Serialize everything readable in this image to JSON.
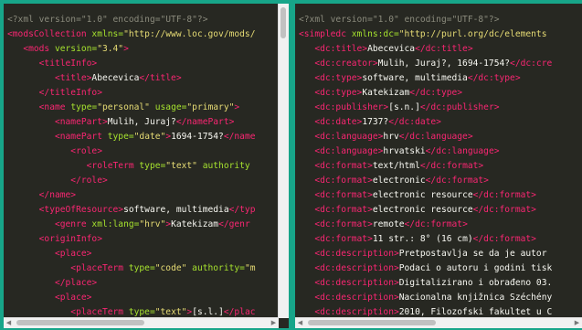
{
  "colors": {
    "background": "#17a589",
    "editor_bg": "#272822",
    "comment": "#8a8a7c",
    "tag": "#f92672",
    "attr": "#a6e22e",
    "string": "#e6db74",
    "text": "#f8f8f2"
  },
  "left_pane": {
    "lines": [
      [
        [
          "c",
          "<?xml version=\"1.0\" encoding=\"UTF-8\"?>"
        ]
      ],
      [
        [
          "g",
          "<modsCollection "
        ],
        [
          "a",
          "xmlns="
        ],
        [
          "s",
          "\"http://www.loc.gov/mods/"
        ]
      ],
      [
        [
          "g",
          "   <mods "
        ],
        [
          "a",
          "version="
        ],
        [
          "s",
          "\"3.4\""
        ],
        [
          "g",
          ">"
        ]
      ],
      [
        [
          "g",
          "      <titleInfo>"
        ]
      ],
      [
        [
          "g",
          "         <title>"
        ],
        [
          "t",
          "Abecevica"
        ],
        [
          "g",
          "</title>"
        ]
      ],
      [
        [
          "g",
          "      </titleInfo>"
        ]
      ],
      [
        [
          "g",
          "      <name "
        ],
        [
          "a",
          "type="
        ],
        [
          "s",
          "\"personal\""
        ],
        [
          "a",
          " usage="
        ],
        [
          "s",
          "\"primary\""
        ],
        [
          "g",
          ">"
        ]
      ],
      [
        [
          "g",
          "         <namePart>"
        ],
        [
          "t",
          "Mulih, Juraj?"
        ],
        [
          "g",
          "</namePart>"
        ]
      ],
      [
        [
          "g",
          "         <namePart "
        ],
        [
          "a",
          "type="
        ],
        [
          "s",
          "\"date\""
        ],
        [
          "g",
          ">"
        ],
        [
          "t",
          "1694-1754?"
        ],
        [
          "g",
          "</name"
        ]
      ],
      [
        [
          "g",
          "            <role>"
        ]
      ],
      [
        [
          "g",
          "               <roleTerm "
        ],
        [
          "a",
          "type="
        ],
        [
          "s",
          "\"text\""
        ],
        [
          "a",
          " authority"
        ]
      ],
      [
        [
          "g",
          "            </role>"
        ]
      ],
      [
        [
          "g",
          "      </name>"
        ]
      ],
      [
        [
          "g",
          "      <typeOfResource>"
        ],
        [
          "t",
          "software, multimedia"
        ],
        [
          "g",
          "</typ"
        ]
      ],
      [
        [
          "g",
          "         <genre "
        ],
        [
          "a",
          "xml:lang="
        ],
        [
          "s",
          "\"hrv\""
        ],
        [
          "g",
          ">"
        ],
        [
          "t",
          "Katekizam"
        ],
        [
          "g",
          "</genr"
        ]
      ],
      [
        [
          "g",
          "      <originInfo>"
        ]
      ],
      [
        [
          "g",
          "         <place>"
        ]
      ],
      [
        [
          "g",
          "            <placeTerm "
        ],
        [
          "a",
          "type="
        ],
        [
          "s",
          "\"code\""
        ],
        [
          "a",
          " authority="
        ],
        [
          "s",
          "\"m"
        ]
      ],
      [
        [
          "g",
          "         </place>"
        ]
      ],
      [
        [
          "g",
          "         <place>"
        ]
      ],
      [
        [
          "g",
          "            <placeTerm "
        ],
        [
          "a",
          "type="
        ],
        [
          "s",
          "\"text\""
        ],
        [
          "g",
          ">"
        ],
        [
          "t",
          "[s.l.]"
        ],
        [
          "g",
          "</plac"
        ]
      ]
    ]
  },
  "right_pane": {
    "lines": [
      [
        [
          "c",
          "<?xml version=\"1.0\" encoding=\"UTF-8\"?>"
        ]
      ],
      [
        [
          "g",
          "<simpledc "
        ],
        [
          "a",
          "xmlns:dc="
        ],
        [
          "s",
          "\"http://purl.org/dc/elements"
        ]
      ],
      [
        [
          "g",
          "   <dc:title>"
        ],
        [
          "t",
          "Abecevica"
        ],
        [
          "g",
          "</dc:title>"
        ]
      ],
      [
        [
          "g",
          "   <dc:creator>"
        ],
        [
          "t",
          "Mulih, Juraj?, 1694-1754?"
        ],
        [
          "g",
          "</dc:cre"
        ]
      ],
      [
        [
          "g",
          "   <dc:type>"
        ],
        [
          "t",
          "software, multimedia"
        ],
        [
          "g",
          "</dc:type>"
        ]
      ],
      [
        [
          "g",
          "   <dc:type>"
        ],
        [
          "t",
          "Katekizam"
        ],
        [
          "g",
          "</dc:type>"
        ]
      ],
      [
        [
          "g",
          "   <dc:publisher>"
        ],
        [
          "t",
          "[s.n.]"
        ],
        [
          "g",
          "</dc:publisher>"
        ]
      ],
      [
        [
          "g",
          "   <dc:date>"
        ],
        [
          "t",
          "1737?"
        ],
        [
          "g",
          "</dc:date>"
        ]
      ],
      [
        [
          "g",
          "   <dc:language>"
        ],
        [
          "t",
          "hrv"
        ],
        [
          "g",
          "</dc:language>"
        ]
      ],
      [
        [
          "g",
          "   <dc:language>"
        ],
        [
          "t",
          "hrvatski"
        ],
        [
          "g",
          "</dc:language>"
        ]
      ],
      [
        [
          "g",
          "   <dc:format>"
        ],
        [
          "t",
          "text/html"
        ],
        [
          "g",
          "</dc:format>"
        ]
      ],
      [
        [
          "g",
          "   <dc:format>"
        ],
        [
          "t",
          "electronic"
        ],
        [
          "g",
          "</dc:format>"
        ]
      ],
      [
        [
          "g",
          "   <dc:format>"
        ],
        [
          "t",
          "electronic resource"
        ],
        [
          "g",
          "</dc:format>"
        ]
      ],
      [
        [
          "g",
          "   <dc:format>"
        ],
        [
          "t",
          "electronic resource"
        ],
        [
          "g",
          "</dc:format>"
        ]
      ],
      [
        [
          "g",
          "   <dc:format>"
        ],
        [
          "t",
          "remote"
        ],
        [
          "g",
          "</dc:format>"
        ]
      ],
      [
        [
          "g",
          "   <dc:format>"
        ],
        [
          "t",
          "11 str.: 8° (16 cm)"
        ],
        [
          "g",
          "</dc:format>"
        ]
      ],
      [
        [
          "g",
          "   <dc:description>"
        ],
        [
          "t",
          "Pretpostavlja se da je autor"
        ]
      ],
      [
        [
          "g",
          "   <dc:description>"
        ],
        [
          "t",
          "Podaci o autoru i godini tisk"
        ]
      ],
      [
        [
          "g",
          "   <dc:description>"
        ],
        [
          "t",
          "Digitalizirano i obrađeno 03."
        ]
      ],
      [
        [
          "g",
          "   <dc:description>"
        ],
        [
          "t",
          "Nacionalna knjižnica Széchény"
        ]
      ],
      [
        [
          "g",
          "   <dc:description>"
        ],
        [
          "t",
          "2010, Filozofski fakultet u C"
        ]
      ]
    ]
  },
  "scrollbar": {
    "left_arrow": "◀",
    "right_arrow": "▶"
  }
}
